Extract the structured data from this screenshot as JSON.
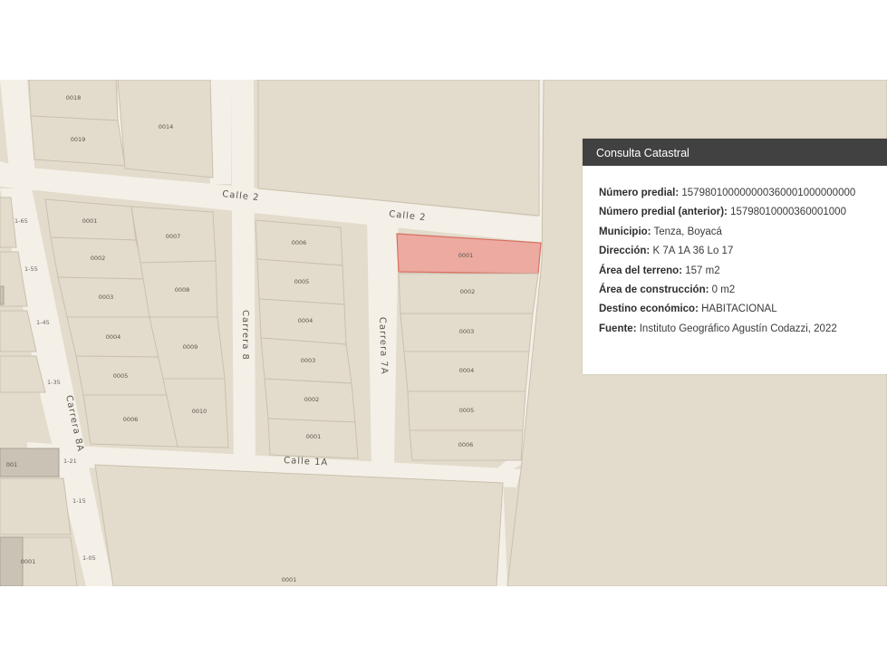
{
  "map": {
    "streets": {
      "calle2_a": "Calle 2",
      "calle2_b": "Calle 2",
      "calle1a": "Calle 1A",
      "carrera8": "Carrera 8",
      "carrera7a": "Carrera 7A",
      "carrera8a": "Carrera 8A"
    },
    "house_numbers": [
      "1-65",
      "1-55",
      "1-45",
      "1-35",
      "1-21",
      "1-15",
      "1-05"
    ],
    "lots": {
      "top_left": [
        "0018",
        "0019",
        "0014"
      ],
      "block_8a": [
        "0001",
        "0002",
        "0003",
        "0004",
        "0005",
        "0006",
        "0007",
        "0008",
        "0009",
        "0010"
      ],
      "block_8": [
        "0006",
        "0005",
        "0004",
        "0003",
        "0002",
        "0001"
      ],
      "block_7a": [
        "0001",
        "0002",
        "0003",
        "0004",
        "0005",
        "0006"
      ],
      "left_edge": [
        "001",
        "0001"
      ],
      "bottom": "0001"
    },
    "selected_lot": "0001"
  },
  "panel": {
    "title": "Consulta Catastral",
    "fields": [
      {
        "label": "Número predial:",
        "value": "157980100000000360001000000000"
      },
      {
        "label": "Número predial (anterior):",
        "value": "15798010000360001000"
      },
      {
        "label": "Municipio:",
        "value": "Tenza, Boyacá"
      },
      {
        "label": "Dirección:",
        "value": "K 7A 1A 36 Lo 17"
      },
      {
        "label": "Área del terreno:",
        "value": "157 m2"
      },
      {
        "label": "Área de construcción:",
        "value": "0 m2"
      },
      {
        "label": "Destino económico:",
        "value": "HABITACIONAL"
      },
      {
        "label": "Fuente:",
        "value": "Instituto Geográfico Agustín Codazzi, 2022"
      }
    ]
  },
  "colors": {
    "road": "#f4f0e8",
    "lot": "#e3dccd",
    "selected_lot": "#ecaaa0",
    "panel_header": "#414141"
  }
}
